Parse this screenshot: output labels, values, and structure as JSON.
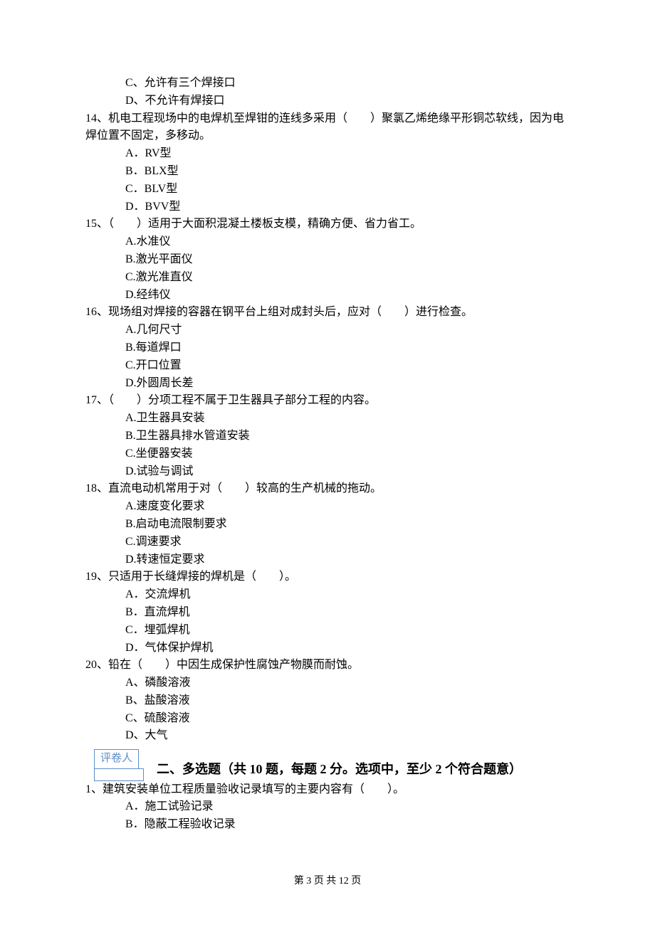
{
  "q13_options": {
    "c": "C、允许有三个焊接口",
    "d": "D、不允许有焊接口"
  },
  "q14": {
    "stem": "14、机电工程现场中的电焊机至焊钳的连线多采用（　　）聚氯乙烯绝缘平形铜芯软线，因为电焊位置不固定，多移动。",
    "a": "A．RV型",
    "b": "B．BLX型",
    "c": "C．BLV型",
    "d": "D．BVV型"
  },
  "q15": {
    "stem": "15、（　　）适用于大面积混凝土楼板支模，精确方便、省力省工。",
    "a": "A.水准仪",
    "b": "B.激光平面仪",
    "c": "C.激光准直仪",
    "d": "D.经纬仪"
  },
  "q16": {
    "stem": "16、现场组对焊接的容器在钢平台上组对成封头后，应对（　　）进行检查。",
    "a": "A.几何尺寸",
    "b": "B.每道焊口",
    "c": "C.开口位置",
    "d": "D.外圆周长差"
  },
  "q17": {
    "stem": "17、（　　）分项工程不属于卫生器具子部分工程的内容。",
    "a": "A.卫生器具安装",
    "b": "B.卫生器具排水管道安装",
    "c": "C.坐便器安装",
    "d": "D.试验与调试"
  },
  "q18": {
    "stem": "18、直流电动机常用于对（　　）较高的生产机械的拖动。",
    "a": "A.速度变化要求",
    "b": "B.启动电流限制要求",
    "c": "C.调速要求",
    "d": "D.转速恒定要求"
  },
  "q19": {
    "stem": "19、只适用于长缝焊接的焊机是（　　）。",
    "a": "A．交流焊机",
    "b": "B．直流焊机",
    "c": "C．埋弧焊机",
    "d": "D．气体保护焊机"
  },
  "q20": {
    "stem": "20、铅在（　　）中因生成保护性腐蚀产物膜而耐蚀。",
    "a": "A、磷酸溶液",
    "b": "B、盐酸溶液",
    "c": "C、硫酸溶液",
    "d": "D、大气"
  },
  "grader_label": "评卷人",
  "section2_title": "二、多选题（共 10 题，每题 2 分。选项中，至少 2 个符合题意）",
  "mq1": {
    "stem": "1、建筑安装单位工程质量验收记录填写的主要内容有（　　）。",
    "a": "A．施工试验记录",
    "b": "B．隐蔽工程验收记录"
  },
  "footer": "第 3 页 共 12 页"
}
